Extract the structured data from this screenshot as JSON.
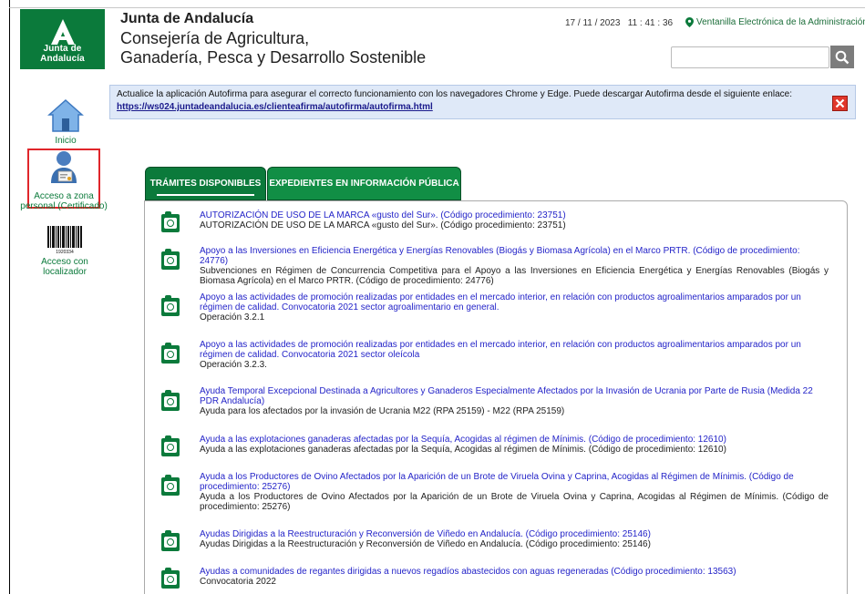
{
  "header": {
    "logo_text": "Junta de Andalucía",
    "title": "Junta de Andalucía",
    "subtitle_line1": "Consejería de Agricultura,",
    "subtitle_line2": "Ganadería, Pesca y Desarrollo Sostenible",
    "date": "17 / 11 / 2023",
    "time": "11 : 41 : 36",
    "ventanilla_link": "Ventanilla Electrónica de la Administración",
    "search_value": "",
    "search_icon": "search-icon"
  },
  "banner": {
    "text": "Actualice la aplicación Autofirma para asegurar el correcto funcionamiento con los navegadores Chrome y Edge. Puede descargar Autofirma desde el siguiente enlace:",
    "link": "https://ws024.juntadeandalucia.es/clienteafirma/autofirma/autofirma.html",
    "close_icon": "close-icon",
    "bg_color": "#dfe9f8"
  },
  "sidebar": {
    "inicio": "Inicio",
    "acceso_line1": "Acceso a zona",
    "acceso_line2": "personal (Certificado)",
    "localizador_line1": "Acceso con",
    "localizador_line2": "localizador",
    "barcode_text": "1920334"
  },
  "tabs": {
    "tramites": "TRÁMITES DISPONIBLES",
    "expedientes": "EXPEDIENTES EN INFORMACIÓN PÚBLICA",
    "accent": "#0b7a3b"
  },
  "items": [
    {
      "link": "AUTORIZACIÓN DE USO DE LA MARCA «gusto del Sur». (Código procedimiento: 23751)",
      "desc": "AUTORIZACIÓN DE USO DE LA MARCA «gusto del Sur». (Código procedimiento: 23751)"
    },
    {
      "link": "Apoyo a las Inversiones en Eficiencia Energética y Energías Renovables (Biogás y Biomasa Agrícola) en el Marco PRTR. (Código de procedimiento: 24776)",
      "desc": "Subvenciones en Régimen de Concurrencia Competitiva para el Apoyo a las Inversiones en Eficiencia Energética y Energías Renovables (Biogás y Biomasa Agrícola) en el Marco PRTR. (Código de procedimiento: 24776)"
    },
    {
      "link": "Apoyo a las actividades de promoción realizadas por entidades en el mercado interior, en relación con productos agroalimentarios amparados por un régimen de calidad. Convocatoria 2021 sector agroalimentario en general.",
      "desc": "Operación 3.2.1"
    },
    {
      "link": "Apoyo a las actividades de promoción realizadas por entidades en el mercado interior, en relación con productos agroalimentarios amparados por un régimen de calidad. Convocatoria 2021 sector oleícola",
      "desc": "Operación 3.2.3."
    },
    {
      "link": "Ayuda Temporal Excepcional Destinada a Agricultores y Ganaderos Especialmente Afectados por la Invasión de Ucrania por Parte de Rusia (Medida 22 PDR Andalucía)",
      "desc": "Ayuda para los afectados por la invasión de Ucrania M22 (RPA 25159) - M22 (RPA 25159)"
    },
    {
      "link": "Ayuda a las explotaciones ganaderas afectadas por la Sequía, Acogidas al régimen de Mínimis. (Código de procedimiento: 12610)",
      "desc": "Ayuda a las explotaciones ganaderas afectadas por la Sequía, Acogidas al régimen de Mínimis. (Código de procedimiento: 12610)"
    },
    {
      "link": "Ayuda a los Productores de Ovino Afectados por la Aparición de un Brote de Viruela Ovina y Caprina, Acogidas al Régimen de Mínimis. (Código de procedimiento: 25276)",
      "desc": "Ayuda a los Productores de Ovino Afectados por la Aparición de un Brote de Viruela Ovina y Caprina, Acogidas al Régimen de Mínimis. (Código de procedimiento: 25276)"
    },
    {
      "link": "Ayudas Dirigidas a la Reestructuración y Reconversión de Viñedo en Andalucía. (Código procedimiento: 25146)",
      "desc": "Ayudas Dirigidas a la Reestructuración y Reconversión de Viñedo en Andalucía. (Código procedimiento: 25146)"
    },
    {
      "link": "Ayudas a comunidades de regantes dirigidas a nuevos regadíos abastecidos con aguas regeneradas (Código procedimiento: 13563)",
      "desc": "Convocatoria 2022"
    }
  ]
}
